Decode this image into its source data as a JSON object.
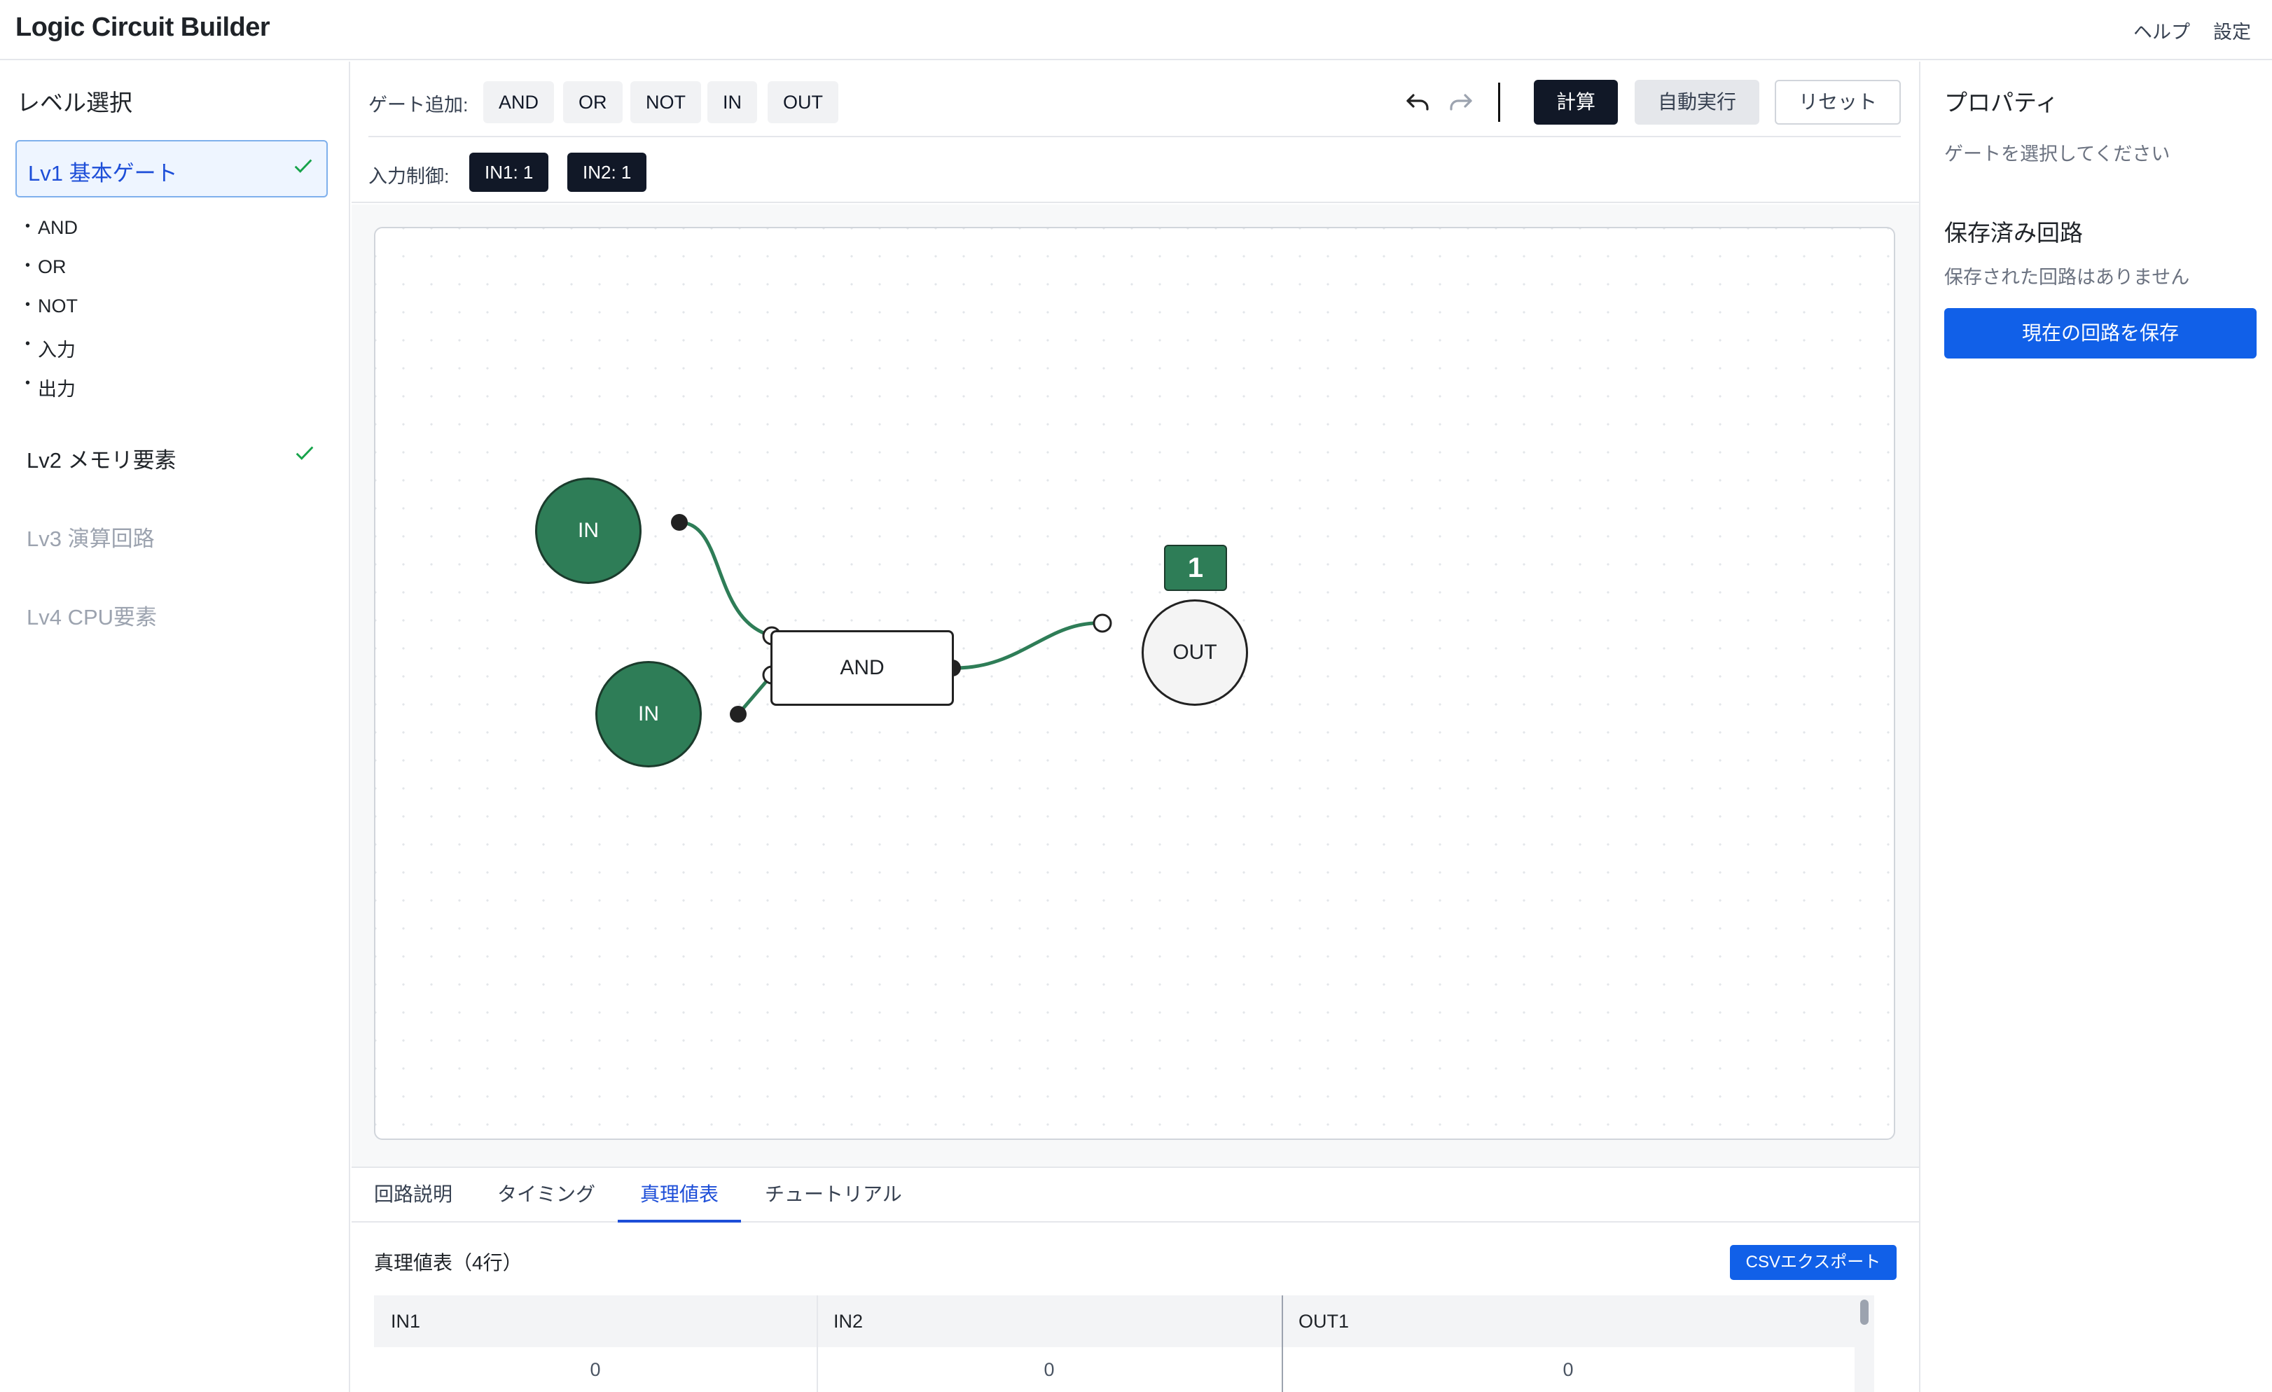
{
  "header": {
    "title": "Logic Circuit Builder",
    "help": "ヘルプ",
    "settings": "設定"
  },
  "sidebar": {
    "title": "レベル選択",
    "levels": [
      {
        "label": "Lv1 基本ゲート",
        "completed": true,
        "state": "active"
      },
      {
        "label": "Lv2 メモリ要素",
        "completed": true,
        "state": "unlocked"
      },
      {
        "label": "Lv3 演算回路",
        "completed": false,
        "state": "locked"
      },
      {
        "label": "Lv4 CPU要素",
        "completed": false,
        "state": "locked"
      }
    ],
    "gates": [
      "AND",
      "OR",
      "NOT",
      "入力",
      "出力"
    ]
  },
  "toolbar": {
    "add_gate_label": "ゲート追加:",
    "gates": [
      "AND",
      "OR",
      "NOT",
      "IN",
      "OUT"
    ],
    "undo_icon": "undo-icon",
    "redo_icon": "redo-icon",
    "calculate": "計算",
    "auto_run": "自動実行",
    "reset": "リセット",
    "input_control_label": "入力制御:",
    "inputs": [
      "IN1: 1",
      "IN2: 1"
    ]
  },
  "circuit": {
    "in1_label": "IN",
    "in2_label": "IN",
    "gate_label": "AND",
    "out_label": "OUT",
    "out_value": "1",
    "wire_color": "#2e7d57",
    "node_color": "#2e7d57"
  },
  "tabs": [
    "回路説明",
    "タイミング",
    "真理値表",
    "チュートリアル"
  ],
  "active_tab": "真理値表",
  "truth_table": {
    "title": "真理値表（4行）",
    "export": "CSVエクスポート",
    "columns": [
      "IN1",
      "IN2",
      "OUT1"
    ],
    "rows": [
      [
        "0",
        "0",
        "0"
      ]
    ]
  },
  "properties": {
    "title": "プロパティ",
    "empty": "ゲートを選択してください",
    "saved_title": "保存済み回路",
    "saved_empty": "保存された回路はありません",
    "save_button": "現在の回路を保存"
  },
  "colors": {
    "accent": "#1160e8",
    "success": "#16a34a",
    "dark": "#111827"
  }
}
